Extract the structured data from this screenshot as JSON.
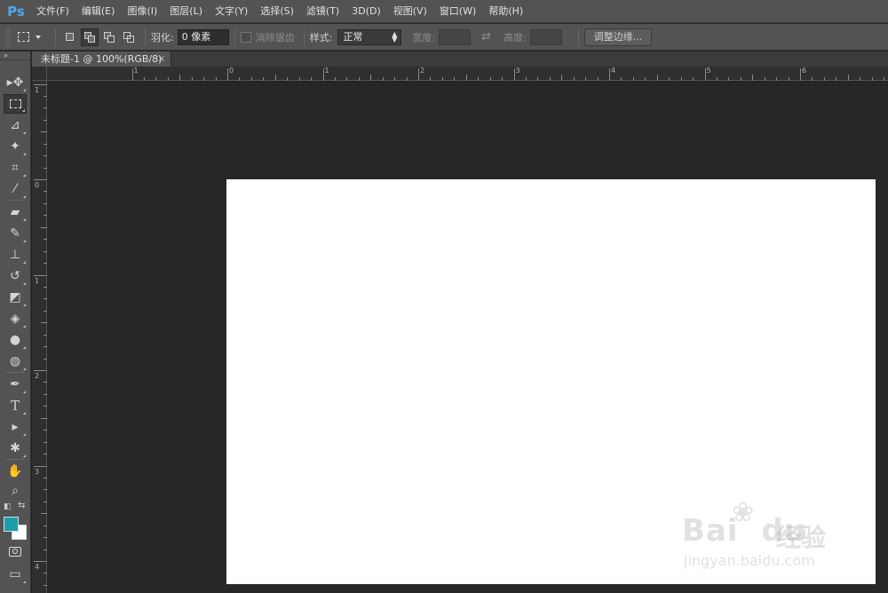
{
  "app": {
    "logo": "Ps",
    "accent": "#4fa9e6"
  },
  "menu": [
    {
      "label": "文件(F)"
    },
    {
      "label": "编辑(E)"
    },
    {
      "label": "图像(I)"
    },
    {
      "label": "图层(L)"
    },
    {
      "label": "文字(Y)"
    },
    {
      "label": "选择(S)"
    },
    {
      "label": "滤镜(T)"
    },
    {
      "label": "3D(D)"
    },
    {
      "label": "视图(V)"
    },
    {
      "label": "窗口(W)"
    },
    {
      "label": "帮助(H)"
    }
  ],
  "options": {
    "feather_label": "羽化:",
    "feather_value": "0 像素",
    "antialias_label": "消除锯齿",
    "style_label": "样式:",
    "style_value": "正常",
    "width_label": "宽度:",
    "height_label": "高度:",
    "refine_edge_label": "调整边缘..."
  },
  "document": {
    "tab_title": "未标题-1 @ 100%(RGB/8)",
    "close_glyph": "×"
  },
  "rulers": {
    "horizontal": [
      "1",
      "0",
      "1",
      "2",
      "3",
      "4",
      "5",
      "6"
    ],
    "vertical": [
      "1",
      "0",
      "1",
      "2",
      "3",
      "4"
    ]
  },
  "colors": {
    "foreground": "#1a9fa8",
    "background": "#ffffff",
    "canvas": "#ffffff",
    "workspace": "#282629"
  },
  "watermark": {
    "brand": "Bai",
    "brand_end": "du",
    "brand_cn": "经验",
    "url": "jingyan.baidu.com"
  }
}
